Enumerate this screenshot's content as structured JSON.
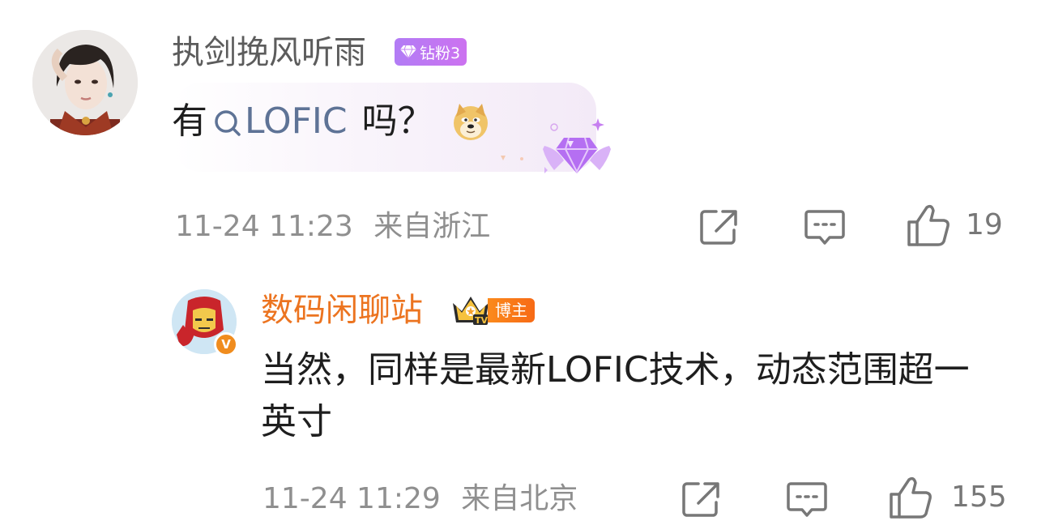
{
  "comments": [
    {
      "username": "执剑挽风听雨",
      "badge": "钻粉3",
      "text_prefix": "有",
      "topic_link": "LOFIC",
      "text_suffix": "吗？",
      "emoji": "doge-emoji",
      "timestamp": "11-24 11:23",
      "location": "来自浙江",
      "likes": "19"
    },
    {
      "username": "数码闲聊站",
      "badge": "博主",
      "text": "当然，同样是最新LOFIC技术，动态范围超一英寸",
      "timestamp": "11-24 11:29",
      "location": "来自北京",
      "likes": "155"
    }
  ],
  "icons": {
    "share": "share-icon",
    "comment": "comment-icon",
    "like": "thumbs-up-icon",
    "search": "search-icon",
    "verified": "verified-icon"
  },
  "colors": {
    "username_default": "#5c5c5c",
    "username_blogger": "#ec7420",
    "topic_link": "#5e7396",
    "fan_badge": "#b27cf5",
    "blogger_badge": "#f76a16"
  }
}
